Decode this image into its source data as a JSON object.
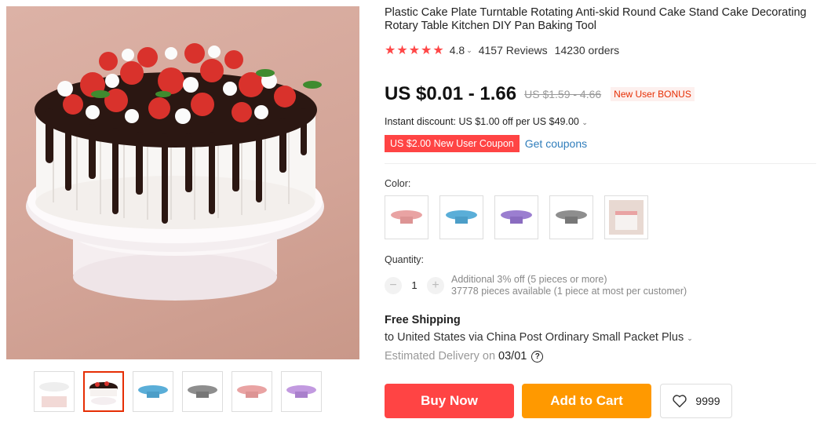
{
  "product": {
    "title": "Plastic Cake Plate Turntable Rotating Anti-skid Round Cake Stand Cake Decorating Rotary Table Kitchen DIY Pan Baking Tool",
    "rating_stars": "★★★★★",
    "rating_value": "4.8",
    "reviews": "4157 Reviews",
    "orders": "14230 orders"
  },
  "price": {
    "current": "US $0.01 - 1.66",
    "original": "US $1.59 - 4.66",
    "bonus_badge": "New User BONUS"
  },
  "discount": {
    "text": "Instant discount: US $1.00 off per US $49.00"
  },
  "coupon": {
    "label": "US $2.00 New User Coupon",
    "link": "Get coupons"
  },
  "color": {
    "label": "Color:",
    "options": [
      {
        "name": "pink",
        "hex": "#e9a3a3"
      },
      {
        "name": "blue",
        "hex": "#5aaed8"
      },
      {
        "name": "purple",
        "hex": "#9b7ed0"
      },
      {
        "name": "gray",
        "hex": "#8e8e8e"
      },
      {
        "name": "photo",
        "hex": "#e8d9d2"
      }
    ]
  },
  "quantity": {
    "label": "Quantity:",
    "value": "1",
    "minus": "−",
    "plus": "+",
    "offer": "Additional 3% off (5 pieces or more)",
    "available": "37778 pieces available (1 piece at most per customer)"
  },
  "shipping": {
    "title": "Free Shipping",
    "line": "to United States via China Post Ordinary Small Packet Plus",
    "est_label": "Estimated Delivery on",
    "est_date": "03/01",
    "help": "?"
  },
  "actions": {
    "buy": "Buy Now",
    "cart": "Add to Cart",
    "wish_count": "9999"
  },
  "colors_theme": {
    "accent": "#ff4747",
    "cart": "#ff9900",
    "link": "#2f7dbb"
  }
}
